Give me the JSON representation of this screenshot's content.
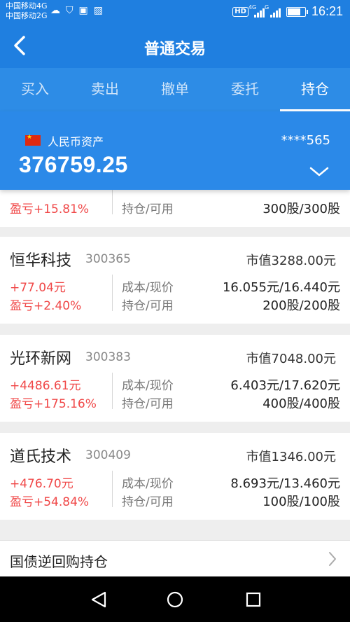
{
  "status_bar": {
    "carrier1": "中国移动4G",
    "carrier2": "中国移动2G",
    "hd": "HD",
    "sig1_label": "4G",
    "sig2_label": "G",
    "time": "16:21"
  },
  "nav": {
    "title": "普通交易"
  },
  "tabs": [
    {
      "label": "买入",
      "active": false
    },
    {
      "label": "卖出",
      "active": false
    },
    {
      "label": "撤单",
      "active": false
    },
    {
      "label": "委托",
      "active": false
    },
    {
      "label": "持仓",
      "active": true
    }
  ],
  "asset": {
    "label": "人民币资产",
    "account": "****565",
    "value": "376759.25"
  },
  "holdings": [
    {
      "name": "",
      "code": "",
      "market_value": "",
      "pl": "",
      "pl_pct": "盈亏+15.81%",
      "cost_label": "",
      "hold_label": "持仓/可用",
      "cost_price": "",
      "hold_qty": "300股/300股",
      "partial": true
    },
    {
      "name": "恒华科技",
      "code": "300365",
      "market_value": "市值3288.00元",
      "pl": "+77.04元",
      "pl_pct": "盈亏+2.40%",
      "cost_label": "成本/现价",
      "hold_label": "持仓/可用",
      "cost_price": "16.055元/16.440元",
      "hold_qty": "200股/200股"
    },
    {
      "name": "光环新网",
      "code": "300383",
      "market_value": "市值7048.00元",
      "pl": "+4486.61元",
      "pl_pct": "盈亏+175.16%",
      "cost_label": "成本/现价",
      "hold_label": "持仓/可用",
      "cost_price": "6.403元/17.620元",
      "hold_qty": "400股/400股"
    },
    {
      "name": "道氏技术",
      "code": "300409",
      "market_value": "市值1346.00元",
      "pl": "+476.70元",
      "pl_pct": "盈亏+54.84%",
      "cost_label": "成本/现价",
      "hold_label": "持仓/可用",
      "cost_price": "8.693元/13.460元",
      "hold_qty": "100股/100股"
    }
  ],
  "repo": {
    "label": "国债逆回购持仓"
  },
  "colors": {
    "primary": "#1f7fe0",
    "profit": "#f04848"
  }
}
